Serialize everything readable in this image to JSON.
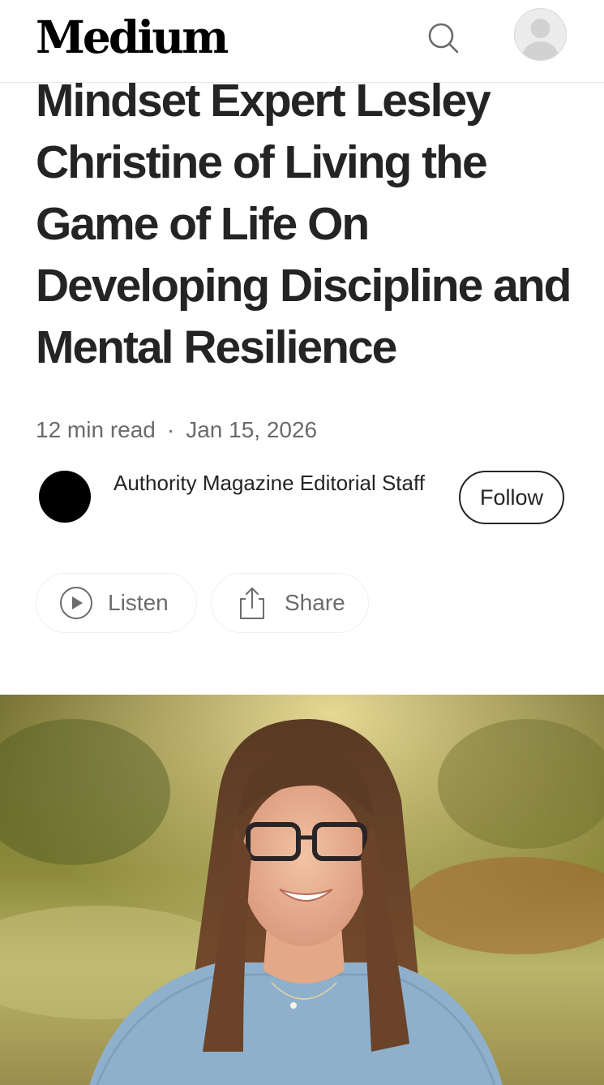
{
  "header": {
    "logo": "Medium",
    "search_icon": "search-icon",
    "profile_icon": "user-avatar-icon"
  },
  "article": {
    "title": "Mindset Expert Lesley Christine of Living the Game of Life On Developing Discipline and Mental Resilience",
    "read_time": "12 min read",
    "separator": "·",
    "date": "Jan 15, 2026",
    "author": "Authority Magazine Editorial Staff",
    "follow_label": "Follow"
  },
  "actions": {
    "listen_label": "Listen",
    "listen_icon": "play-circle-icon",
    "share_label": "Share",
    "share_icon": "share-icon"
  },
  "hero": {
    "description_icon": "portrait-photo"
  },
  "colors": {
    "text": "#242424",
    "muted": "#6b6b6b",
    "border": "#e8e8e8"
  }
}
